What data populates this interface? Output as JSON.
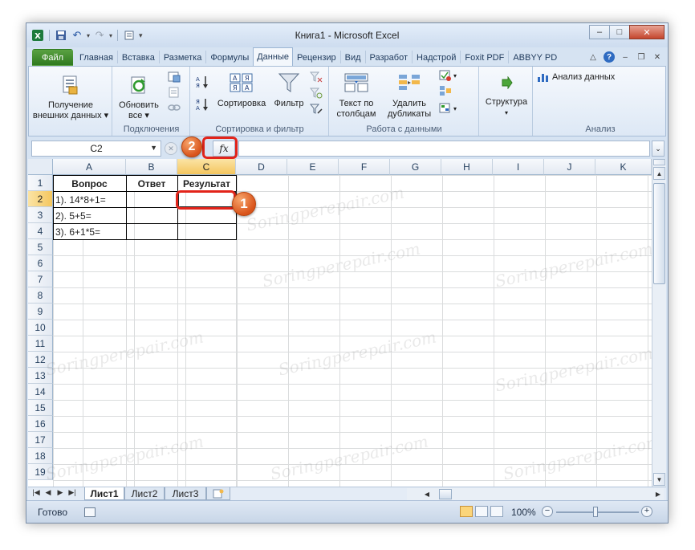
{
  "window": {
    "title": "Книга1 - Microsoft Excel",
    "controls": {
      "minimize": "–",
      "maximize": "□",
      "close": "✕"
    }
  },
  "qat": {
    "undo": "↶",
    "redo": "↷"
  },
  "ribbon": {
    "tabs": [
      {
        "id": "file",
        "label": "Файл"
      },
      {
        "id": "home",
        "label": "Главная"
      },
      {
        "id": "insert",
        "label": "Вставка"
      },
      {
        "id": "layout",
        "label": "Разметка"
      },
      {
        "id": "formulas",
        "label": "Формулы"
      },
      {
        "id": "data",
        "label": "Данные"
      },
      {
        "id": "review",
        "label": "Рецензир"
      },
      {
        "id": "view",
        "label": "Вид"
      },
      {
        "id": "developer",
        "label": "Разработ"
      },
      {
        "id": "addins",
        "label": "Надстрой"
      },
      {
        "id": "foxit",
        "label": "Foxit PDF"
      },
      {
        "id": "abbyy",
        "label": "ABBYY PD"
      }
    ],
    "active_tab": "Данные",
    "groups": {
      "get_external": {
        "button_line1": "Получение",
        "button_line2": "внешних данных ▾"
      },
      "connections": {
        "label": "Подключения",
        "refresh_line1": "Обновить",
        "refresh_line2": "все ▾"
      },
      "sort_filter": {
        "label": "Сортировка и фильтр",
        "sort": "Сортировка",
        "filter": "Фильтр"
      },
      "data_tools": {
        "label": "Работа с данными",
        "text_to_cols_1": "Текст по",
        "text_to_cols_2": "столбцам",
        "remove_dup_1": "Удалить",
        "remove_dup_2": "дубликаты"
      },
      "outline": {
        "structure": "Структура"
      },
      "analysis": {
        "label": "Анализ",
        "data_analysis": "Анализ данных"
      }
    }
  },
  "formula_bar": {
    "name_box": "C2",
    "fx_label": "fx",
    "formula": ""
  },
  "sheet": {
    "columns": [
      "A",
      "B",
      "C",
      "D",
      "E",
      "F",
      "G",
      "H",
      "I",
      "J",
      "K"
    ],
    "rows": [
      "1",
      "2",
      "3",
      "4",
      "5",
      "6",
      "7",
      "8",
      "9",
      "10",
      "11",
      "12",
      "13",
      "14",
      "15",
      "16",
      "17",
      "18",
      "19"
    ],
    "selected_column": "C",
    "selected_row": "2",
    "cells": {
      "A1": "Вопрос",
      "B1": "Ответ",
      "C1": "Результат",
      "A2": "1). 14*8+1=",
      "A3": "2). 5+5=",
      "A4": "3). 6+1*5="
    }
  },
  "sheet_tabs": [
    "Лист1",
    "Лист2",
    "Лист3"
  ],
  "active_sheet": "Лист1",
  "status_bar": {
    "ready": "Готово",
    "zoom": "100%",
    "zoom_minus": "−",
    "zoom_plus": "+"
  },
  "callouts": {
    "step1": "1",
    "step2": "2"
  },
  "watermark": "Soringperepair.com",
  "colors": {
    "file_tab": "#3d8b2a",
    "selection_header": "#f4c65e",
    "callout_badge": "#e06a2a",
    "callout_ring": "#e2241a"
  }
}
